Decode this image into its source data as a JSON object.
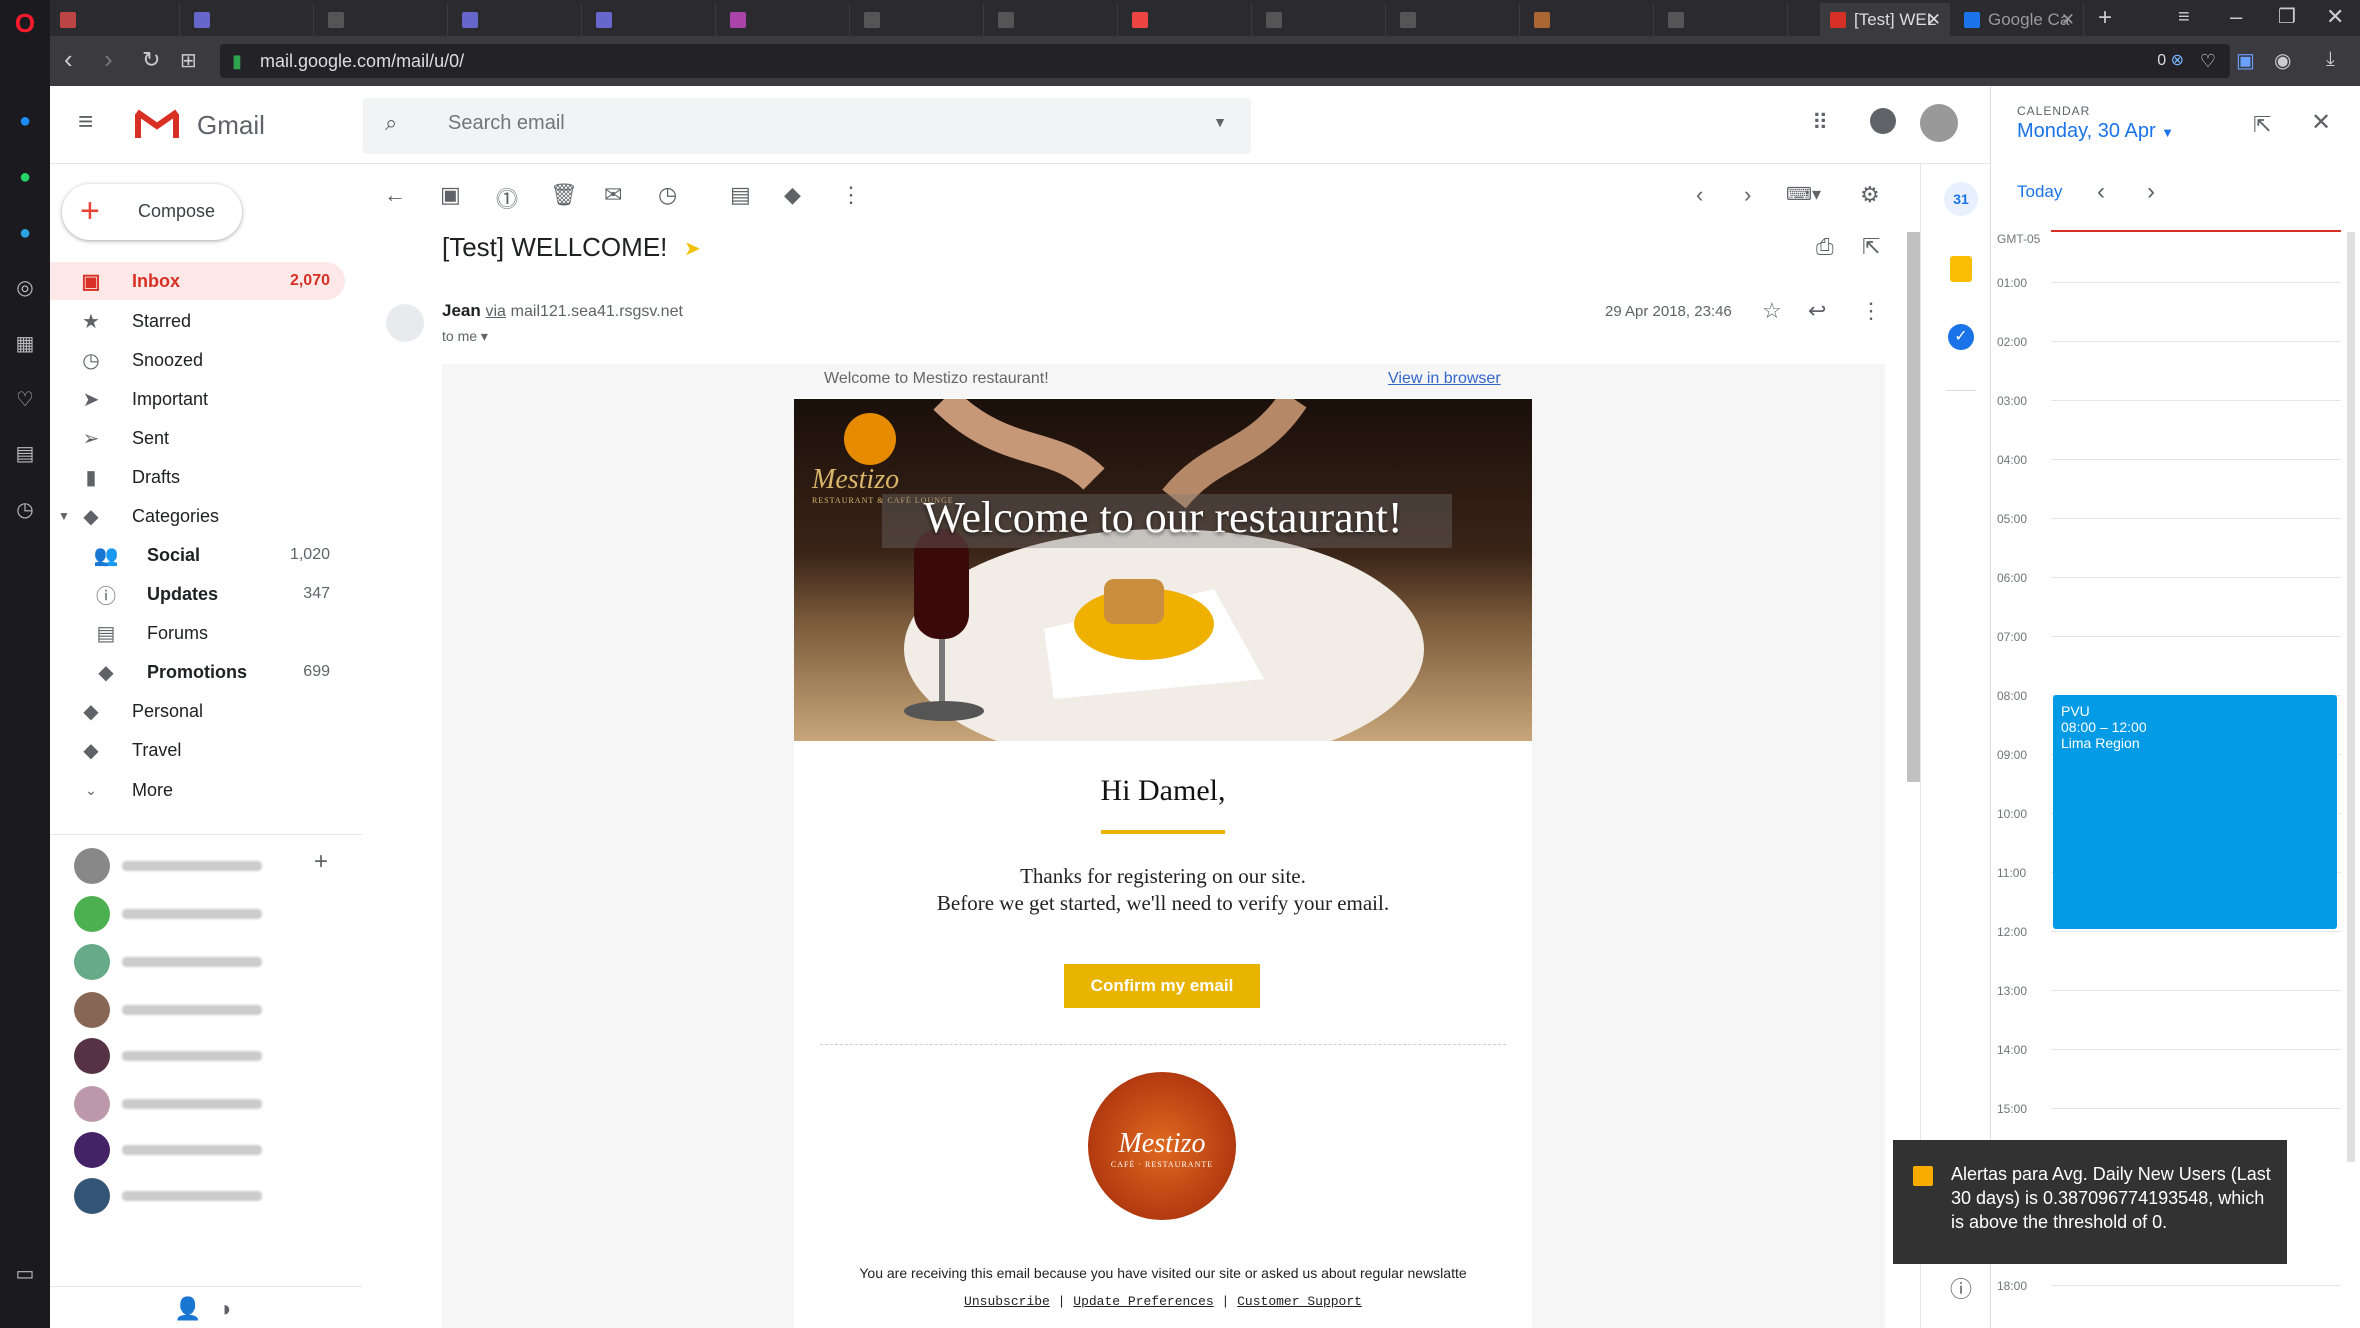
{
  "browser": {
    "tabs": [
      {
        "label": "[Test] WEL",
        "active": true
      },
      {
        "label": "Google Ca",
        "active": false
      }
    ],
    "url": "mail.google.com/mail/u/0/",
    "badge": "0"
  },
  "gmail": {
    "brand": "Gmail",
    "search_placeholder": "Search email",
    "compose_label": "Compose",
    "sidebar": [
      {
        "label": "Inbox",
        "count": "2,070",
        "icon": "inbox-icon"
      },
      {
        "label": "Starred",
        "count": "",
        "icon": "star-icon"
      },
      {
        "label": "Snoozed",
        "count": "",
        "icon": "clock-icon"
      },
      {
        "label": "Important",
        "count": "",
        "icon": "important-icon"
      },
      {
        "label": "Sent",
        "count": "",
        "icon": "send-icon"
      },
      {
        "label": "Drafts",
        "count": "",
        "icon": "draft-icon"
      },
      {
        "label": "Categories",
        "count": "",
        "icon": "label-icon"
      },
      {
        "label": "Social",
        "count": "1,020",
        "icon": "people-icon"
      },
      {
        "label": "Updates",
        "count": "347",
        "icon": "info-icon"
      },
      {
        "label": "Forums",
        "count": "",
        "icon": "forum-icon"
      },
      {
        "label": "Promotions",
        "count": "699",
        "icon": "tag-icon"
      },
      {
        "label": "Personal",
        "count": "",
        "icon": "label-icon"
      },
      {
        "label": "Travel",
        "count": "",
        "icon": "label-icon"
      },
      {
        "label": "More",
        "count": "",
        "icon": "chevron-down-icon"
      }
    ],
    "message": {
      "subject": "[Test] WELLCOME!",
      "sender": "Jean",
      "via_label": "via",
      "via_domain": "mail121.sea41.rsgsv.net",
      "to": "to me",
      "date": "29 Apr 2018, 23:46"
    },
    "email": {
      "preheader": "Welcome to Mestizo restaurant!",
      "view_in_browser": "View in browser",
      "hero_title": "Welcome to our restaurant!",
      "logo_name": "Mestizo",
      "logo_sub": "RESTAURANT & CAFÉ LOUNGE",
      "greeting": "Hi Damel,",
      "body_line1": "Thanks for registering on our site.",
      "body_line2": "Before we get started, we'll need to verify your email.",
      "cta": "Confirm my email",
      "round_logo": "Mestizo",
      "round_logo_sub": "CAFÉ · RESTAURANTE",
      "footer_note": "You are receiving this email because you have visited our site or asked us about regular newslatte",
      "footer_links": [
        "Unsubscribe",
        "Update Preferences",
        "Customer Support"
      ]
    }
  },
  "calendar": {
    "header_small": "CALENDAR",
    "date": "Monday, 30 Apr",
    "today": "Today",
    "timezone": "GMT-05",
    "hours": [
      "01:00",
      "02:00",
      "03:00",
      "04:00",
      "05:00",
      "06:00",
      "07:00",
      "08:00",
      "09:00",
      "10:00",
      "11:00",
      "12:00",
      "13:00",
      "14:00",
      "15:00",
      "18:00"
    ],
    "event": {
      "title": "PVU",
      "time": "08:00 – 12:00",
      "place": "Lima Region"
    }
  },
  "toast": {
    "text": "Alertas para Avg. Daily New Users (Last 30 days) is 0.387096774193548, which is above the threshold of 0."
  },
  "colors": {
    "accent_red": "#d93025",
    "gold": "#e8b400",
    "event_blue": "#039be5"
  }
}
